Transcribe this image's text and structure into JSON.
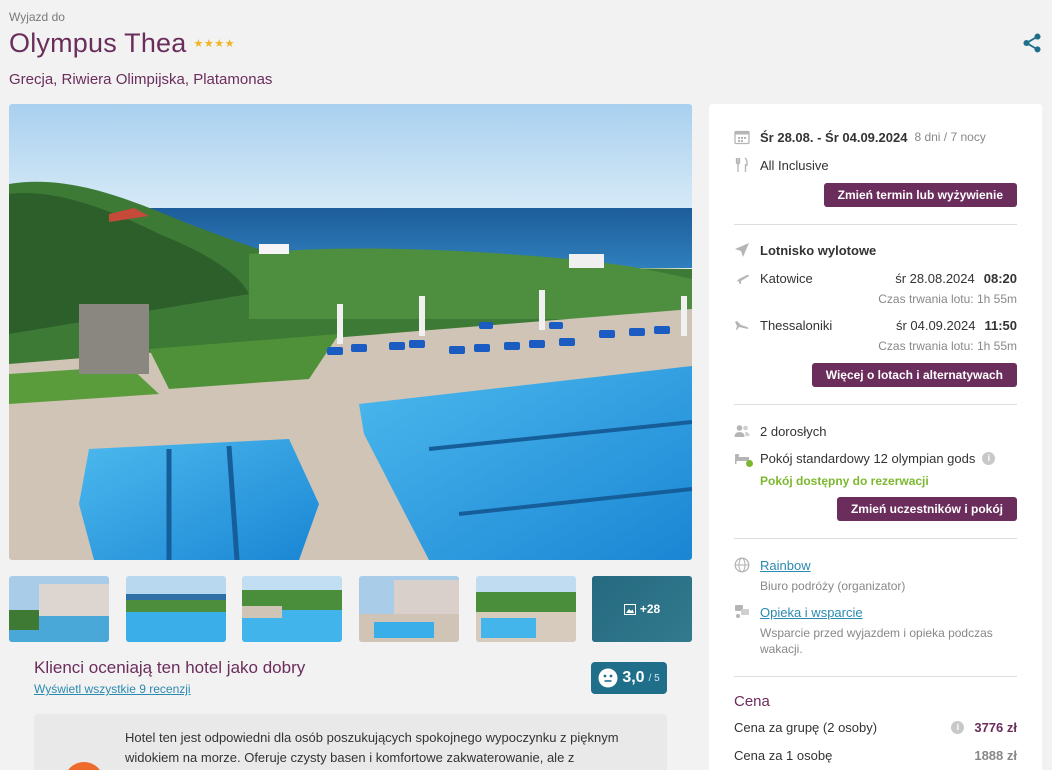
{
  "header": {
    "subtitle": "Wyjazd do",
    "title": "Olympus Thea",
    "stars": "★★★★",
    "location": "Grecja, Riwiera Olimpijska, Platamonas"
  },
  "gallery": {
    "more_label": "+28"
  },
  "reviews": {
    "title": "Klienci oceniają ten hotel jako dobry",
    "link": "Wyświetl wszystkie 9 recenzji",
    "score": "3,0",
    "score_max": "/ 5",
    "review_text": "Hotel ten jest odpowiedni dla osób poszukujących spokojnego wypoczynku z pięknym widokiem na morze. Oferuje czysty basen i komfortowe zakwaterowanie, ale z"
  },
  "panel": {
    "dates": "Śr 28.08. - Śr 04.09.2024",
    "duration": "8 dni / 7 nocy",
    "board": "All Inclusive",
    "change_term_button": "Zmień termin lub wyżywienie",
    "airport_label": "Lotnisko wylotowe",
    "departure": {
      "city": "Katowice",
      "date": "śr 28.08.2024",
      "time": "08:20",
      "duration": "Czas trwania lotu: 1h 55m"
    },
    "return": {
      "city": "Thessaloniki",
      "date": "śr 04.09.2024",
      "time": "11:50",
      "duration": "Czas trwania lotu: 1h 55m"
    },
    "flights_button": "Więcej o lotach i alternatywach",
    "travellers": "2 dorosłych",
    "room": "Pokój standardowy 12 olympian gods",
    "room_status": "Pokój dostępny do rezerwacji",
    "change_participants_button": "Zmień uczestników i pokój",
    "organizer_name": "Rainbow",
    "organizer_desc": "Biuro podróży (organizator)",
    "support_link": "Opieka i wsparcie",
    "support_desc": "Wsparcie przed wyjazdem i opieka podczas wakacji.",
    "price_heading": "Cena",
    "price_group_label": "Cena za grupę (2 osoby)",
    "price_group": "3776 zł",
    "price_person_label": "Cena za 1 osobę",
    "price_person": "1888 zł"
  },
  "colors": {
    "brand": "#6b2d5c",
    "accent": "#1f6f8b",
    "link": "#2a8ab0",
    "available": "#7cb82f"
  },
  "icons": [
    "share-icon",
    "calendar-icon",
    "cutlery-icon",
    "plane-icon",
    "takeoff-icon",
    "landing-icon",
    "people-icon",
    "bed-icon",
    "globe-icon",
    "support-icon",
    "info-icon",
    "gallery-icon",
    "face-icon"
  ]
}
